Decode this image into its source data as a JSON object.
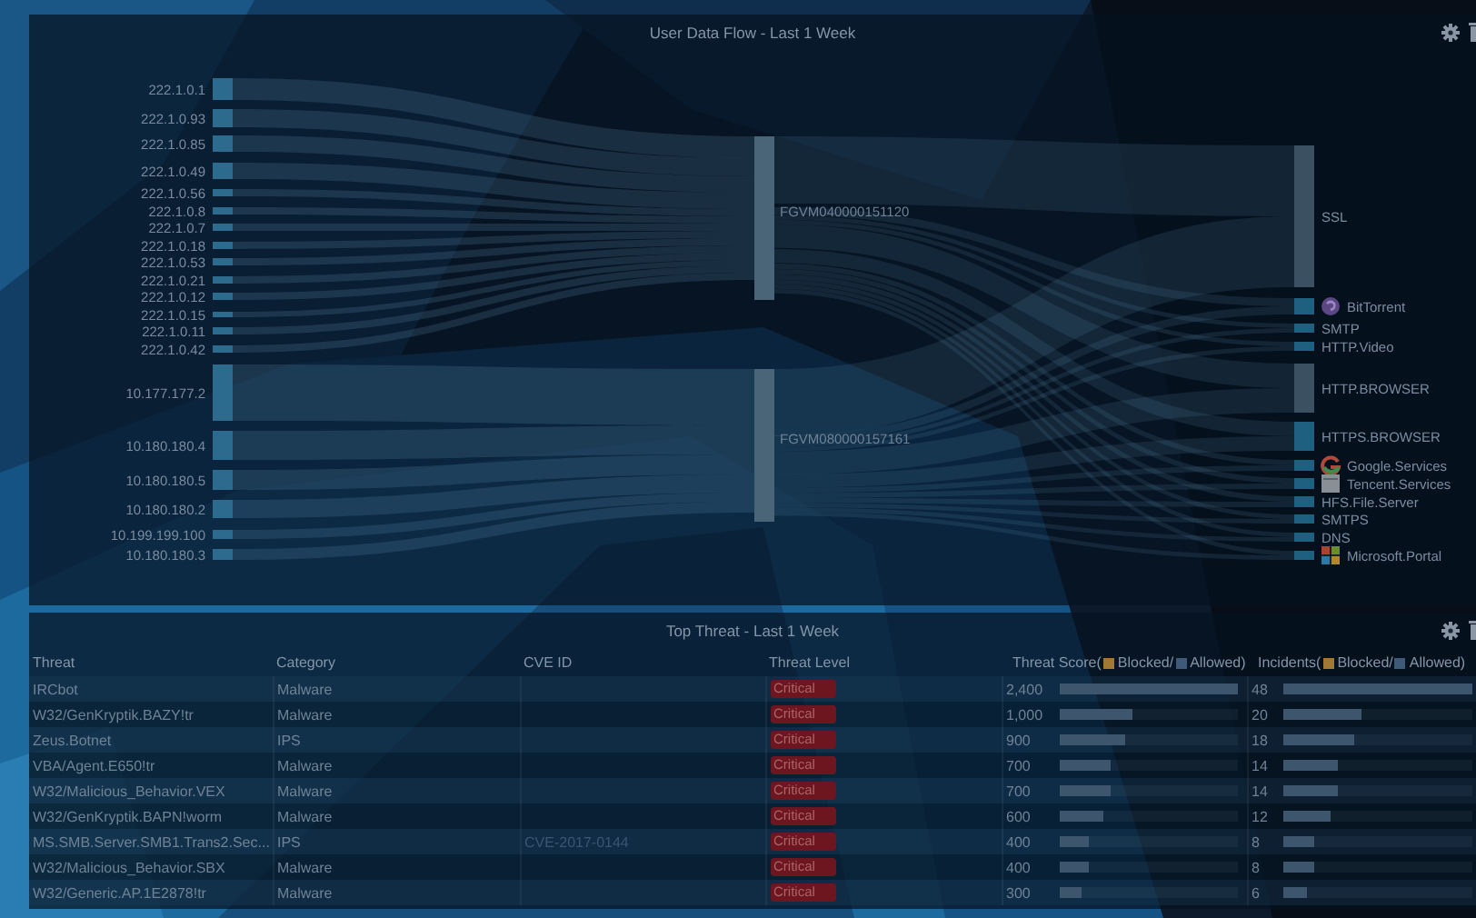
{
  "flow_panel": {
    "title": "User Data Flow - Last 1 Week",
    "sources": [
      {
        "label": "222.1.0.1"
      },
      {
        "label": "222.1.0.93"
      },
      {
        "label": "222.1.0.85"
      },
      {
        "label": "222.1.0.49"
      },
      {
        "label": "222.1.0.56"
      },
      {
        "label": "222.1.0.8"
      },
      {
        "label": "222.1.0.7"
      },
      {
        "label": "222.1.0.18"
      },
      {
        "label": "222.1.0.53"
      },
      {
        "label": "222.1.0.21"
      },
      {
        "label": "222.1.0.12"
      },
      {
        "label": "222.1.0.15"
      },
      {
        "label": "222.1.0.11"
      },
      {
        "label": "222.1.0.42"
      },
      {
        "label": "10.177.177.2"
      },
      {
        "label": "10.180.180.4"
      },
      {
        "label": "10.180.180.5"
      },
      {
        "label": "10.180.180.2"
      },
      {
        "label": "10.199.199.100"
      },
      {
        "label": "10.180.180.3"
      }
    ],
    "devices": [
      {
        "label": "FGVM040000151120"
      },
      {
        "label": "FGVM080000157161"
      }
    ],
    "applications": [
      {
        "label": "SSL",
        "kind": "plain"
      },
      {
        "label": "BitTorrent",
        "kind": "logo"
      },
      {
        "label": "SMTP",
        "kind": "plain"
      },
      {
        "label": "HTTP.Video",
        "kind": "plain"
      },
      {
        "label": "HTTP.BROWSER",
        "kind": "plain"
      },
      {
        "label": "HTTPS.BROWSER",
        "kind": "plain"
      },
      {
        "label": "Google.Services",
        "kind": "logo"
      },
      {
        "label": "Tencent.Services",
        "kind": "logo"
      },
      {
        "label": "HFS.File.Server",
        "kind": "plain"
      },
      {
        "label": "SMTPS",
        "kind": "plain"
      },
      {
        "label": "DNS",
        "kind": "plain"
      },
      {
        "label": "Microsoft.Portal",
        "kind": "logo"
      }
    ]
  },
  "threat_panel": {
    "title": "Top Threat - Last 1 Week",
    "columns": [
      {
        "label": "Threat"
      },
      {
        "label": "Category"
      },
      {
        "label": "CVE ID"
      },
      {
        "label": "Threat Level"
      },
      {
        "label": "Threat Score(",
        "legend": [
          {
            "label": "Blocked/",
            "color": "#a07a35"
          },
          {
            "label": "Allowed)",
            "color": "#3e5a78"
          }
        ]
      },
      {
        "label": "Incidents(",
        "legend": [
          {
            "label": "Blocked/",
            "color": "#a07a35"
          },
          {
            "label": "Allowed)",
            "color": "#3e5a78"
          }
        ]
      }
    ],
    "rows": [
      {
        "threat": "IRCbot",
        "category": "Malware",
        "threat_level": {
          "label": "Critical",
          "kind": "critical"
        },
        "score": {
          "value": "2,400",
          "level": 1
        },
        "incidents": {
          "value": "48",
          "level": 1
        }
      },
      {
        "threat": "W32/GenKryptik.BAZY!tr",
        "category": "Malware",
        "threat_level": {
          "label": "Critical",
          "kind": "critical"
        },
        "score": {
          "value": "1,000",
          "level": 0.417
        },
        "incidents": {
          "value": "20",
          "level": 0.417
        }
      },
      {
        "threat": "Zeus.Botnet",
        "category": "IPS",
        "threat_level": {
          "label": "Critical",
          "kind": "critical"
        },
        "score": {
          "value": "900",
          "level": 0.375
        },
        "incidents": {
          "value": "18",
          "level": 0.375
        }
      },
      {
        "threat": "VBA/Agent.E650!tr",
        "category": "Malware",
        "threat_level": {
          "label": "Critical",
          "kind": "critical"
        },
        "score": {
          "value": "700",
          "level": 0.292
        },
        "incidents": {
          "value": "14",
          "level": 0.292
        }
      },
      {
        "threat": "W32/Malicious_Behavior.VEX",
        "category": "Malware",
        "threat_level": {
          "label": "Critical",
          "kind": "critical"
        },
        "score": {
          "value": "700",
          "level": 0.292
        },
        "incidents": {
          "value": "14",
          "level": 0.292
        }
      },
      {
        "threat": "W32/GenKryptik.BAPN!worm",
        "category": "Malware",
        "threat_level": {
          "label": "Critical",
          "kind": "critical"
        },
        "score": {
          "value": "600",
          "level": 0.25
        },
        "incidents": {
          "value": "12",
          "level": 0.25
        }
      },
      {
        "threat": "MS.SMB.Server.SMB1.Trans2.Sec...",
        "category": "IPS",
        "cve_id": "CVE-2017-0144",
        "threat_level": {
          "label": "Critical",
          "kind": "critical"
        },
        "score": {
          "value": "400",
          "level": 0.167
        },
        "incidents": {
          "value": "8",
          "level": 0.167
        }
      },
      {
        "threat": "W32/Malicious_Behavior.SBX",
        "category": "Malware",
        "threat_level": {
          "label": "Critical",
          "kind": "critical"
        },
        "score": {
          "value": "400",
          "level": 0.167
        },
        "incidents": {
          "value": "8",
          "level": 0.167
        }
      },
      {
        "threat": "W32/Generic.AP.1E2878!tr",
        "category": "Malware",
        "threat_level": {
          "label": "Critical",
          "kind": "critical"
        },
        "score": {
          "value": "300",
          "level": 0.125
        },
        "incidents": {
          "value": "6",
          "level": 0.125
        }
      }
    ]
  }
}
